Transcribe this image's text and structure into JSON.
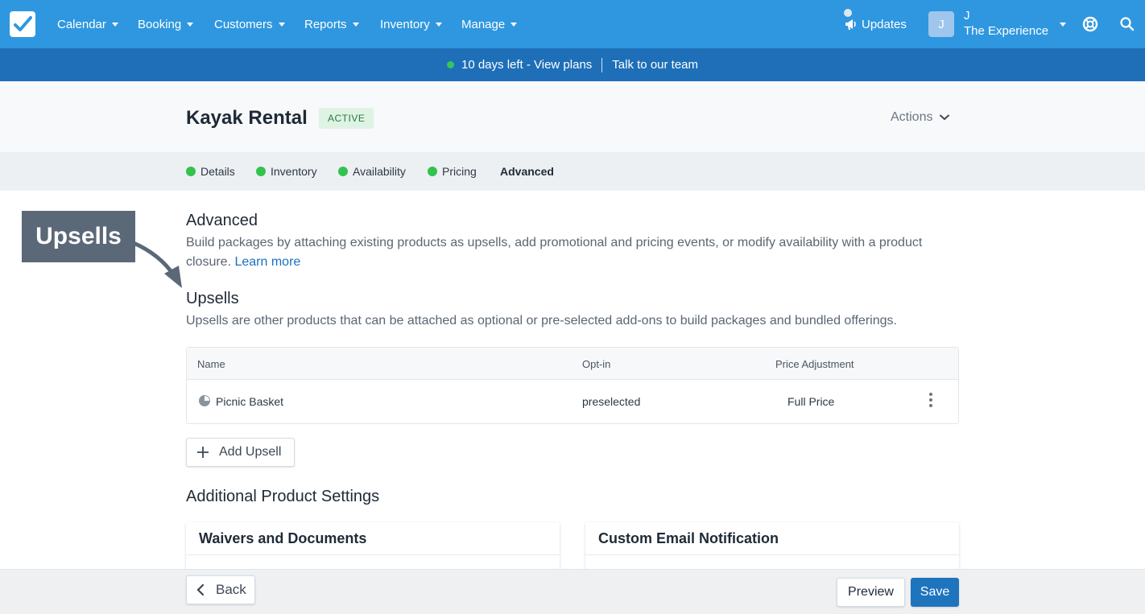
{
  "nav": {
    "items": [
      {
        "label": "Calendar"
      },
      {
        "label": "Booking"
      },
      {
        "label": "Customers"
      },
      {
        "label": "Reports"
      },
      {
        "label": "Inventory"
      },
      {
        "label": "Manage"
      }
    ],
    "updates_label": "Updates",
    "avatar_initial": "J",
    "user_name": "J",
    "company_name": "The Experience"
  },
  "banner": {
    "trial_text": "10 days left - View plans",
    "talk_text": "Talk to our team"
  },
  "product": {
    "title": "Kayak Rental",
    "status": "ACTIVE",
    "actions_label": "Actions"
  },
  "tabs": [
    {
      "label": "Details",
      "complete": true
    },
    {
      "label": "Inventory",
      "complete": true
    },
    {
      "label": "Availability",
      "complete": true
    },
    {
      "label": "Pricing",
      "complete": true
    },
    {
      "label": "Advanced",
      "complete": false
    }
  ],
  "annotation": {
    "label": "Upsells"
  },
  "advanced": {
    "heading": "Advanced",
    "description": "Build packages by attaching existing products as upsells, add promotional and pricing events, or modify availability with a product closure.",
    "learn_more": "Learn more"
  },
  "upsells": {
    "heading": "Upsells",
    "description": "Upsells are other products that can be attached as optional or pre-selected add-ons to build packages and bundled offerings.",
    "columns": [
      "Name",
      "Opt-in",
      "Price Adjustment"
    ],
    "rows": [
      {
        "name": "Picnic Basket",
        "opt_in": "preselected",
        "price_adjustment": "Full Price"
      }
    ],
    "add_label": "Add Upsell"
  },
  "additional": {
    "heading": "Additional Product Settings",
    "cards": [
      {
        "title": "Waivers and Documents"
      },
      {
        "title": "Custom Email Notification"
      }
    ]
  },
  "footer": {
    "back_label": "Back",
    "preview_label": "Preview",
    "save_label": "Save"
  },
  "colors": {
    "nav_bg": "#2f97e0",
    "banner_bg": "#1e6fb8",
    "status_green": "#34c24f",
    "primary": "#1f74be",
    "link": "#1a6fc4"
  }
}
